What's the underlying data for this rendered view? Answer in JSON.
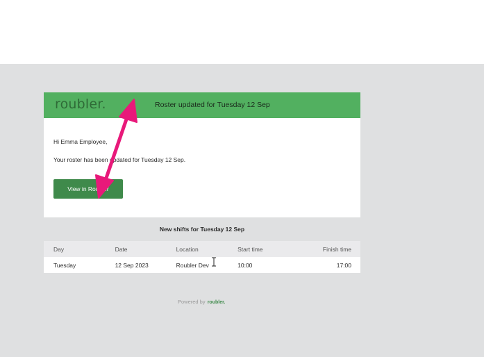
{
  "email": {
    "brand": "roubler.",
    "header_title": "Roster updated for Tuesday 12 Sep",
    "greeting": "Hi Emma Employee,",
    "message": "Your roster has been updated for Tuesday 12 Sep.",
    "button_label": "View in Roubler"
  },
  "shifts": {
    "heading": "New shifts for Tuesday 12 Sep",
    "columns": [
      "Day",
      "Date",
      "Location",
      "Start time",
      "Finish time"
    ],
    "rows": [
      [
        "Tuesday",
        "12 Sep 2023",
        "Roubler Dev",
        "10:00",
        "17:00"
      ]
    ]
  },
  "footer": {
    "powered_by": "Powered by",
    "brand": "roubler."
  },
  "colors": {
    "header_green": "#52b060",
    "button_green": "#3f8a4b",
    "annotation_pink": "#e8197a"
  },
  "icons": {
    "annotation": "double-headed-arrow-icon",
    "cursor": "text-cursor-icon"
  }
}
